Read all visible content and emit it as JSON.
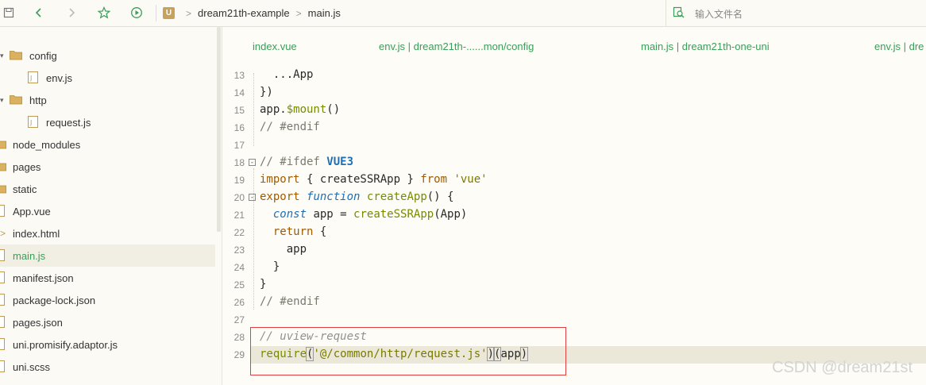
{
  "toolbar": {
    "icons": [
      "save-icon",
      "back-arrow-icon",
      "forward-arrow-icon",
      "star-icon",
      "run-icon"
    ],
    "breadcrumb": {
      "logo": "U",
      "project": "dream21th-example",
      "file": "main.js"
    },
    "file_search_placeholder": "输入文件名"
  },
  "sidebar": {
    "items": [
      {
        "label": "config",
        "type": "folder",
        "expanded": true
      },
      {
        "label": "env.js",
        "type": "file"
      },
      {
        "label": "http",
        "type": "folder",
        "expanded": true
      },
      {
        "label": "request.js",
        "type": "file"
      },
      {
        "label": "node_modules",
        "type": "folder"
      },
      {
        "label": "pages",
        "type": "folder"
      },
      {
        "label": "static",
        "type": "folder"
      },
      {
        "label": "App.vue",
        "type": "file"
      },
      {
        "label": "index.html",
        "type": "file"
      },
      {
        "label": "main.js",
        "type": "file",
        "active": true
      },
      {
        "label": "manifest.json",
        "type": "file"
      },
      {
        "label": "package-lock.json",
        "type": "file"
      },
      {
        "label": "pages.json",
        "type": "file"
      },
      {
        "label": "uni.promisify.adaptor.js",
        "type": "file"
      },
      {
        "label": "uni.scss",
        "type": "file"
      }
    ]
  },
  "tabs": [
    {
      "label": "index.vue"
    },
    {
      "label": "env.js | dream21th-......mon/config"
    },
    {
      "label": "main.js | dream21th-one-uni"
    },
    {
      "label": "env.js | dre"
    }
  ],
  "editor": {
    "lines": [
      {
        "num": "13"
      },
      {
        "num": "14"
      },
      {
        "num": "15"
      },
      {
        "num": "16"
      },
      {
        "num": "17"
      },
      {
        "num": "18"
      },
      {
        "num": "19"
      },
      {
        "num": "20"
      },
      {
        "num": "21"
      },
      {
        "num": "22"
      },
      {
        "num": "23"
      },
      {
        "num": "24"
      },
      {
        "num": "25"
      },
      {
        "num": "26"
      },
      {
        "num": "27"
      },
      {
        "num": "28"
      },
      {
        "num": "29"
      }
    ],
    "fold_markers": [
      "⊟",
      "⊟"
    ]
  },
  "colors": {
    "accent_green": "#3b9d5a",
    "highlight_box": "#e04040"
  },
  "watermark": "CSDN @dream21st"
}
